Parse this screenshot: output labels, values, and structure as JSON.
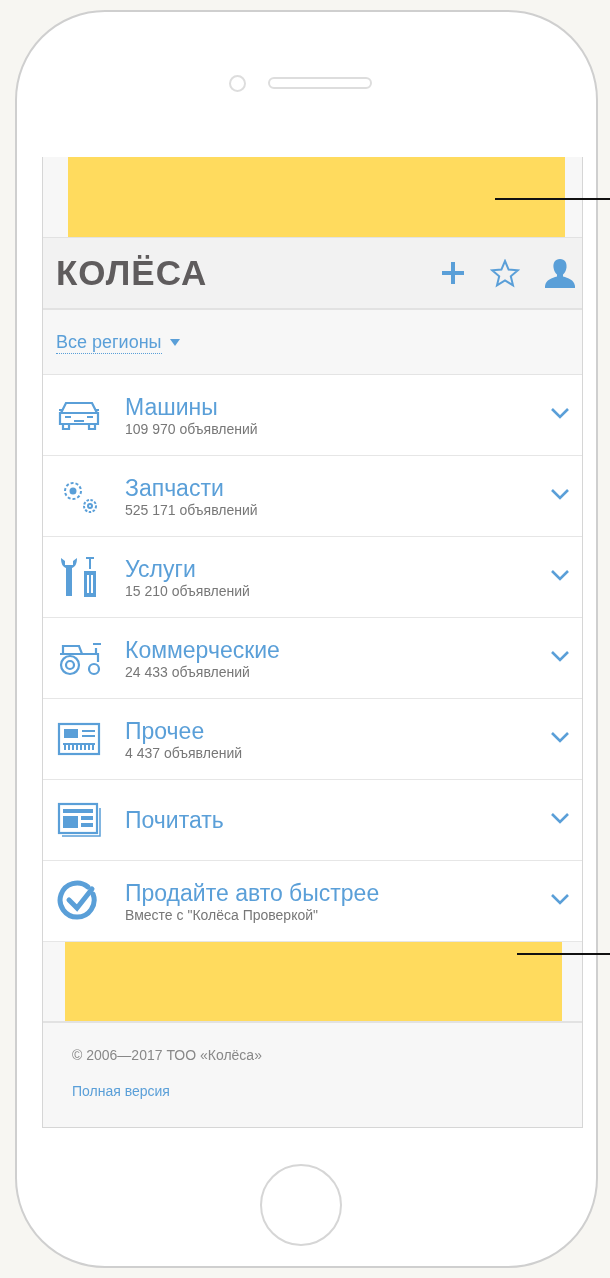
{
  "header": {
    "logo": "КОЛЁСА"
  },
  "region": {
    "label": "Все регионы"
  },
  "categories": [
    {
      "kind": "car",
      "title": "Машины",
      "subtitle": "109 970 объявлений",
      "expanded": false
    },
    {
      "kind": "gears",
      "title": "Запчасти",
      "subtitle": "525 171 объявлений",
      "expanded": false
    },
    {
      "kind": "tools",
      "title": "Услуги",
      "subtitle": "15 210 объявлений",
      "expanded": false
    },
    {
      "kind": "tractor",
      "title": "Коммерческие",
      "subtitle": "24 433 объявлений",
      "expanded": false
    },
    {
      "kind": "board",
      "title": "Прочее",
      "subtitle": "4 437 объявлений",
      "expanded": false
    },
    {
      "kind": "newspaper",
      "title": "Почитать",
      "expanded": false
    },
    {
      "kind": "check",
      "title": "Продайте авто быстрее",
      "subtitle": "Вместе с \"Колёса Проверкой\"",
      "expanded": false
    }
  ],
  "footer": {
    "copyright": "© 2006—2017 ТОО «Колёса»",
    "link": "Полная версия"
  }
}
